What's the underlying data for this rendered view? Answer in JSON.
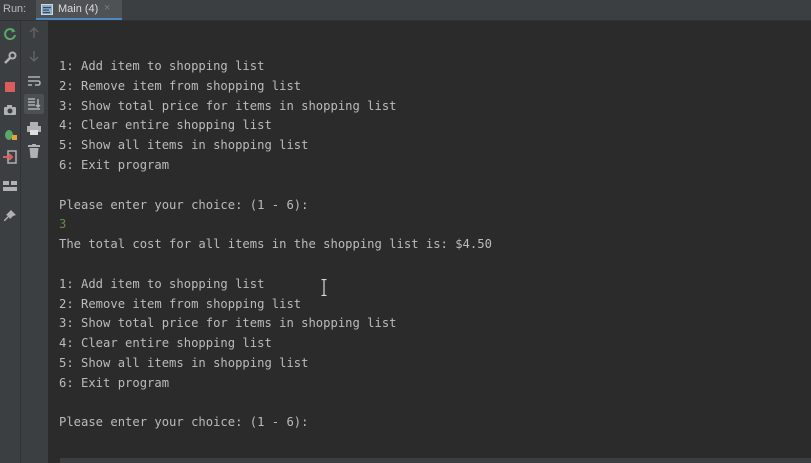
{
  "window": {
    "run_label": "Run:",
    "tab_label": "Main (4)",
    "tab_close": "×"
  },
  "console": {
    "lines": [
      {
        "text": "1: Add item to shopping list",
        "type": "output"
      },
      {
        "text": "2: Remove item from shopping list",
        "type": "output"
      },
      {
        "text": "3: Show total price for items in shopping list",
        "type": "output"
      },
      {
        "text": "4: Clear entire shopping list",
        "type": "output"
      },
      {
        "text": "5: Show all items in shopping list",
        "type": "output"
      },
      {
        "text": "6: Exit program",
        "type": "output"
      },
      {
        "text": "",
        "type": "output"
      },
      {
        "text": "Please enter your choice: (1 - 6):",
        "type": "output"
      },
      {
        "text": "3",
        "type": "input"
      },
      {
        "text": "The total cost for all items in the shopping list is: $4.50",
        "type": "output"
      },
      {
        "text": "",
        "type": "output"
      },
      {
        "text": "1: Add item to shopping list",
        "type": "output"
      },
      {
        "text": "2: Remove item from shopping list",
        "type": "output"
      },
      {
        "text": "3: Show total price for items in shopping list",
        "type": "output"
      },
      {
        "text": "4: Clear entire shopping list",
        "type": "output"
      },
      {
        "text": "5: Show all items in shopping list",
        "type": "output"
      },
      {
        "text": "6: Exit program",
        "type": "output"
      },
      {
        "text": "",
        "type": "output"
      },
      {
        "text": "Please enter your choice: (1 - 6):",
        "type": "output"
      }
    ]
  },
  "icons": {
    "left_toolbar": [
      "rerun-icon",
      "wrench-icon",
      "stop-icon",
      "camera-icon",
      "debug-icon",
      "login-icon",
      "layout-icon",
      "pin-icon"
    ],
    "right_toolbar": [
      "up-arrow-icon",
      "down-arrow-icon",
      "soft-wrap-icon",
      "scroll-to-end-icon",
      "print-icon",
      "trash-icon"
    ]
  },
  "colors": {
    "console_bg": "#2b2b2b",
    "output_text": "#bbbbbb",
    "input_text": "#5e8c4a",
    "toolbar_bg": "#3c3f41",
    "tab_accent": "#4a88c7"
  }
}
